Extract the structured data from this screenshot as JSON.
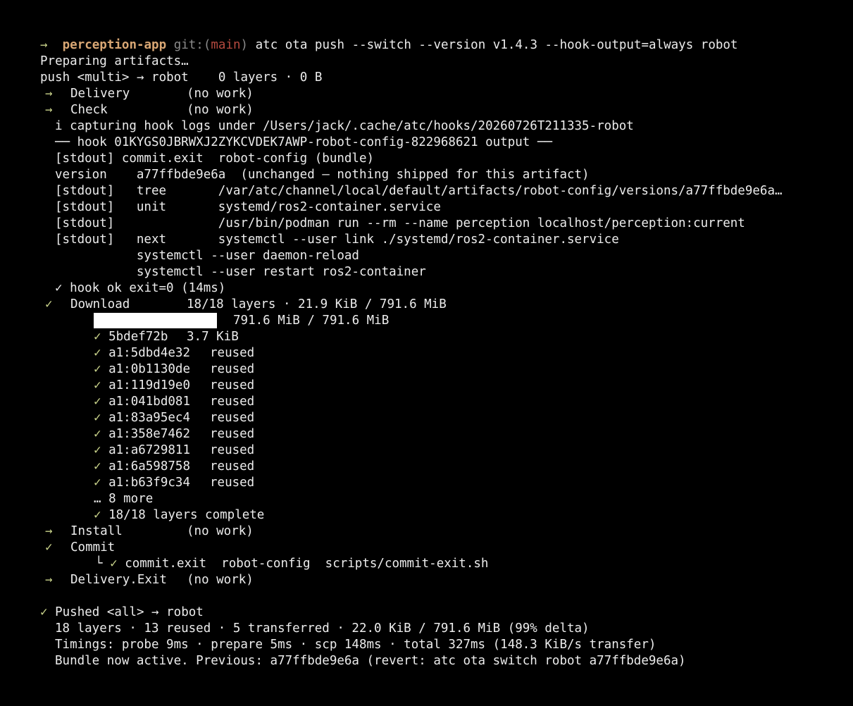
{
  "prompt": {
    "arrow": "→",
    "dir": "perception-app",
    "git_open": "git:(",
    "branch": "main",
    "git_close": ")",
    "command": "atc ota push --switch --version v1.4.3 --hook-output=always robot"
  },
  "preparing": "Preparing artifacts…",
  "push_line": "push <multi> → robot    0 layers · 0 B",
  "stages": {
    "delivery": {
      "mark": "→",
      "label": "Delivery",
      "status": "(no work)"
    },
    "check": {
      "mark": "→",
      "label": "Check",
      "status": "(no work)"
    },
    "download": {
      "mark": "✓",
      "label": "Download",
      "status": "18/18 layers · 21.9 KiB / 791.6 MiB"
    },
    "install": {
      "mark": "→",
      "label": "Install",
      "status": "(no work)"
    },
    "commit": {
      "mark": "✓",
      "label": "Commit"
    },
    "delivery_exit": {
      "mark": "→",
      "label": "Delivery.Exit",
      "status": "(no work)"
    }
  },
  "hook": {
    "capturing": "i capturing hook logs under /Users/jack/.cache/atc/hooks/20260726T211335-robot",
    "header": "── hook 01KYGS0JBRWXJ2ZYKCVDEK7AWP-robot-config-822968621 output ──",
    "lines": [
      "[stdout] commit.exit  robot-config (bundle)",
      "version    a77ffbde9e6a  (unchanged — nothing shipped for this artifact)",
      "[stdout]   tree       /var/atc/channel/local/default/artifacts/robot-config/versions/a77ffbde9e6a…",
      "[stdout]   unit       systemd/ros2-container.service",
      "[stdout]              /usr/bin/podman run --rm --name perception localhost/perception:current",
      "[stdout]   next       systemctl --user link ./systemd/ros2-container.service",
      "           systemctl --user daemon-reload",
      "           systemctl --user restart ros2-container"
    ],
    "ok_mark": "✓",
    "ok": "hook ok exit=0 (14ms)"
  },
  "download": {
    "progress": 1.0,
    "progress_text": "791.6 MiB / 791.6 MiB",
    "layer_mark": "✓",
    "layers": [
      {
        "id": "5bdef72b",
        "info": "3.7 KiB"
      },
      {
        "id": "a1:5dbd4e32",
        "info": "reused"
      },
      {
        "id": "a1:0b1130de",
        "info": "reused"
      },
      {
        "id": "a1:119d19e0",
        "info": "reused"
      },
      {
        "id": "a1:041bd081",
        "info": "reused"
      },
      {
        "id": "a1:83a95ec4",
        "info": "reused"
      },
      {
        "id": "a1:358e7462",
        "info": "reused"
      },
      {
        "id": "a1:a6729811",
        "info": "reused"
      },
      {
        "id": "a1:6a598758",
        "info": "reused"
      },
      {
        "id": "a1:b63f9c34",
        "info": "reused"
      }
    ],
    "more": "… 8 more",
    "complete": "18/18 layers complete"
  },
  "commit_detail": {
    "branch": "└",
    "mark": "✓",
    "text": "commit.exit  robot-config  scripts/commit-exit.sh"
  },
  "summary": {
    "mark": "✓",
    "pushed": "Pushed <all> → robot",
    "stats": "18 layers · 13 reused · 5 transferred · 22.0 KiB / 791.6 MiB (99% delta)",
    "timings": "Timings: probe 9ms · prepare 5ms · scp 148ms · total 327ms (148.3 KiB/s transfer)",
    "bundle": "Bundle now active. Previous: a77ffbde9e6a (revert: atc ota switch robot a77ffbde9e6a)"
  }
}
